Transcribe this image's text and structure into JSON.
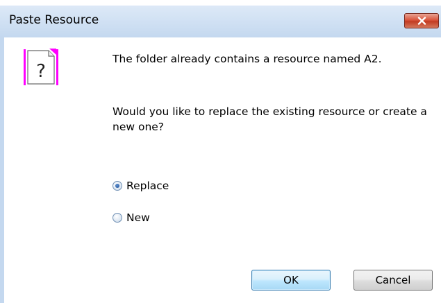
{
  "window": {
    "title": "Paste Resource"
  },
  "icons": {
    "close": "close-icon",
    "document": "question-document-icon"
  },
  "message": {
    "line1": "The folder already contains a resource named A2.",
    "line2": "Would you like to replace the existing resource or create a new one?"
  },
  "options": {
    "replace": {
      "label": "Replace",
      "selected": true
    },
    "new": {
      "label": "New",
      "selected": false
    }
  },
  "buttons": {
    "ok": "OK",
    "cancel": "Cancel"
  },
  "colors": {
    "title_bar": "#cfe0f3",
    "close_button": "#c94a30",
    "icon_accent": "#ff00ff"
  }
}
